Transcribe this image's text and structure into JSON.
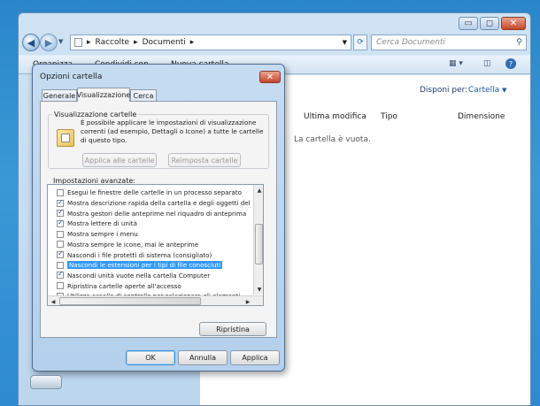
{
  "explorer": {
    "breadcrumb": [
      "Raccolte",
      "Documenti"
    ],
    "search_placeholder": "Cerca Documenti",
    "toolbar": [
      "Organizza",
      "Condividi con",
      "Nuova cartella"
    ],
    "arrange_label": "Disponi per:",
    "arrange_value": "Cartella",
    "columns": [
      "Ultima modifica",
      "Tipo",
      "Dimensione"
    ],
    "empty_message": "La cartella è vuota."
  },
  "dialog": {
    "title": "Opzioni cartella",
    "tabs": [
      "Generale",
      "Visualizzazione",
      "Cerca"
    ],
    "active_tab": "Visualizzazione",
    "folder_view_group": "Visualizzazione cartelle",
    "folder_view_text": "È possibile applicare le impostazioni di visualizzazione correnti (ad esempio, Dettagli o Icone) a tutte le cartelle di questo tipo.",
    "apply_to_folders": "Applica alle cartelle",
    "reset_folders": "Reimposta cartelle",
    "advanced_label": "Impostazioni avanzate:",
    "advanced_items": [
      {
        "label": "Esegui le finestre delle cartelle in un processo separato",
        "checked": false,
        "selected": false
      },
      {
        "label": "Mostra descrizione rapida della cartella e degli oggetti del",
        "checked": true,
        "selected": false
      },
      {
        "label": "Mostra gestori delle anteprime nel riquadro di anteprima",
        "checked": true,
        "selected": false
      },
      {
        "label": "Mostra lettere di unità",
        "checked": true,
        "selected": false
      },
      {
        "label": "Mostra sempre i menu",
        "checked": false,
        "selected": false
      },
      {
        "label": "Mostra sempre le icone, mai le anteprime",
        "checked": false,
        "selected": false
      },
      {
        "label": "Nascondi i file protetti di sistema (consigliato)",
        "checked": true,
        "selected": false
      },
      {
        "label": "Nascondi le estensioni per i tipi di file conosciuti",
        "checked": false,
        "selected": true
      },
      {
        "label": "Nascondi unità vuote nella cartella Computer",
        "checked": true,
        "selected": false
      },
      {
        "label": "Ripristina cartelle aperte all'accesso",
        "checked": false,
        "selected": false
      },
      {
        "label": "Utilizza caselle di controllo per selezionare gli elementi",
        "checked": false,
        "selected": false
      }
    ],
    "restore_defaults": "Ripristina",
    "ok": "OK",
    "cancel": "Annulla",
    "apply": "Applica"
  }
}
